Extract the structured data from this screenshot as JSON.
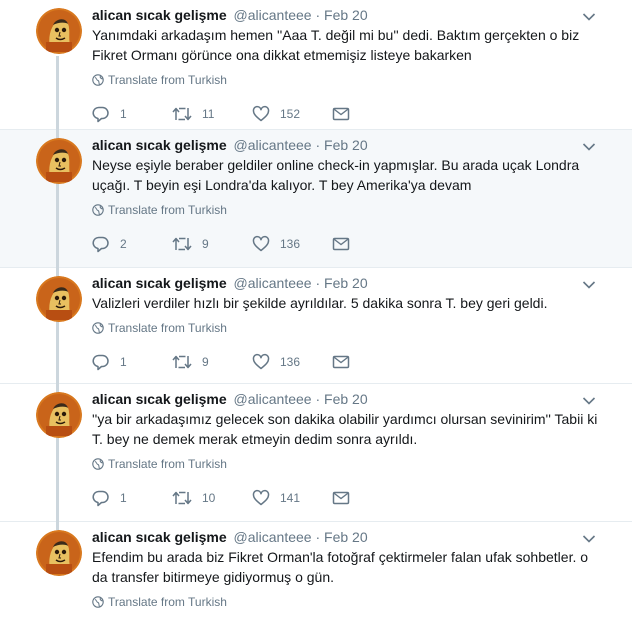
{
  "tweets": [
    {
      "name": "alican sıcak gelişme",
      "handle": "@alicanteee",
      "dot": "·",
      "date": "Feb 20",
      "text": "Yanımdaki arkadaşım hemen ''Aaa T. değil mi bu'' dedi. Baktım gerçekten o biz Fikret Ormanı görünce ona  dikkat etmemişiz listeye bakarken",
      "translate": "Translate from Turkish",
      "replies": "1",
      "retweets": "11",
      "likes": "152"
    },
    {
      "name": "alican sıcak gelişme",
      "handle": "@alicanteee",
      "dot": "·",
      "date": "Feb 20",
      "text": "Neyse eşiyle beraber geldiler online check-in yapmışlar. Bu arada uçak Londra uçağı. T beyin eşi Londra'da kalıyor. T bey Amerika'ya devam",
      "translate": "Translate from Turkish",
      "replies": "2",
      "retweets": "9",
      "likes": "136"
    },
    {
      "name": "alican sıcak gelişme",
      "handle": "@alicanteee",
      "dot": "·",
      "date": "Feb 20",
      "text": "Valizleri verdiler hızlı bir şekilde ayrıldılar. 5 dakika sonra T. bey geri geldi.",
      "translate": "Translate from Turkish",
      "replies": "1",
      "retweets": "9",
      "likes": "136"
    },
    {
      "name": "alican sıcak gelişme",
      "handle": "@alicanteee",
      "dot": "·",
      "date": "Feb 20",
      "text": "''ya bir arkadaşımız gelecek son dakika olabilir yardımcı olursan sevinirim'' Tabii ki T. bey ne demek merak etmeyin dedim sonra ayrıldı.",
      "translate": "Translate from Turkish",
      "replies": "1",
      "retweets": "10",
      "likes": "141"
    },
    {
      "name": "alican sıcak gelişme",
      "handle": "@alicanteee",
      "dot": "·",
      "date": "Feb 20",
      "text": "Efendim bu arada biz Fikret Orman'la fotoğraf çektirmeler falan ufak sohbetler. o da transfer bitirmeye gidiyormuş o gün.",
      "translate": "Translate from Turkish",
      "replies": "",
      "retweets": "",
      "likes": ""
    }
  ],
  "colors": {
    "thread_line": "#ccd6dd",
    "muted_text": "#657786",
    "highlight_background": "#f5f8fa"
  },
  "icons": [
    "avatar-drawing",
    "chevron-down-icon",
    "globe-icon",
    "reply-icon",
    "retweet-icon",
    "like-icon",
    "message-icon"
  ]
}
